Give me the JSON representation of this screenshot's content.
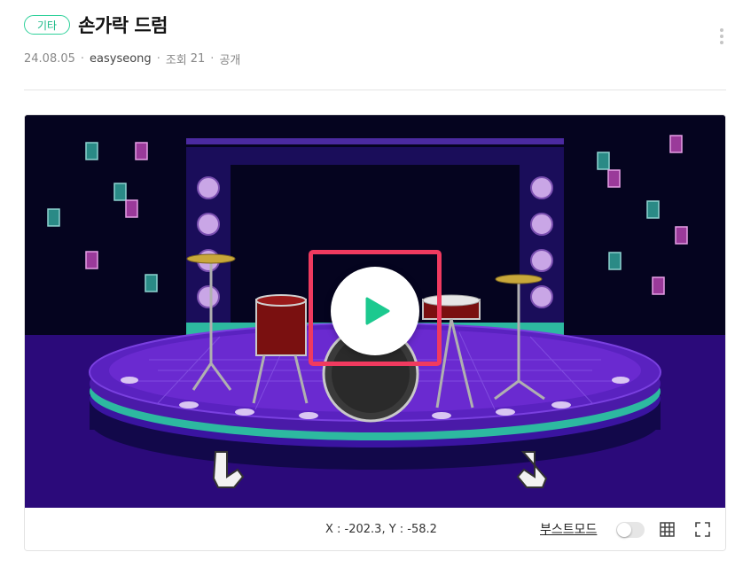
{
  "header": {
    "category": "기타",
    "title": "손가락 드럼",
    "date": "24.08.05",
    "author": "easyseong",
    "views_label": "조회",
    "views": "21",
    "visibility": "공개",
    "separator": "·"
  },
  "player": {
    "coords_text": "X : -202.3, Y : -58.2",
    "boost_label": "부스트모드",
    "boost_on": false,
    "play_icon": "play-icon",
    "grid_icon": "grid-icon",
    "fullscreen_icon": "fullscreen-icon"
  },
  "colors": {
    "accent": "#17b886",
    "highlight": "#f03a5f",
    "stage_background": "#05041f",
    "stage_purple": "#4a1aa8",
    "stage_teal": "#2db9a0"
  }
}
